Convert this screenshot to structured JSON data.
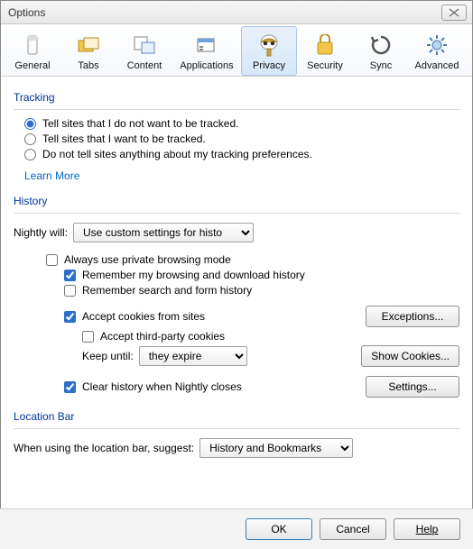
{
  "window": {
    "title": "Options"
  },
  "tabs": [
    {
      "label": "General"
    },
    {
      "label": "Tabs"
    },
    {
      "label": "Content"
    },
    {
      "label": "Applications"
    },
    {
      "label": "Privacy"
    },
    {
      "label": "Security"
    },
    {
      "label": "Sync"
    },
    {
      "label": "Advanced"
    }
  ],
  "tracking": {
    "title": "Tracking",
    "opt_do_not_track": "Tell sites that I do not want to be tracked.",
    "opt_want_track": "Tell sites that I want to be tracked.",
    "opt_no_pref": "Do not tell sites anything about my tracking preferences.",
    "learn_more": "Learn More"
  },
  "history": {
    "title": "History",
    "nightly_will": "Nightly will:",
    "mode_options": [
      "Use custom settings for history"
    ],
    "always_private": "Always use private browsing mode",
    "remember_browsing": "Remember my browsing and download history",
    "remember_search": "Remember search and form history",
    "accept_cookies": "Accept cookies from sites",
    "exceptions": "Exceptions...",
    "accept_third_party": "Accept third-party cookies",
    "keep_until": "Keep until:",
    "keep_options": [
      "they expire"
    ],
    "show_cookies": "Show Cookies...",
    "clear_on_close": "Clear history when Nightly closes",
    "settings": "Settings..."
  },
  "location_bar": {
    "title": "Location Bar",
    "suggest_label": "When using the location bar, suggest:",
    "suggest_options": [
      "History and Bookmarks"
    ]
  },
  "footer": {
    "ok": "OK",
    "cancel": "Cancel",
    "help": "Help"
  }
}
